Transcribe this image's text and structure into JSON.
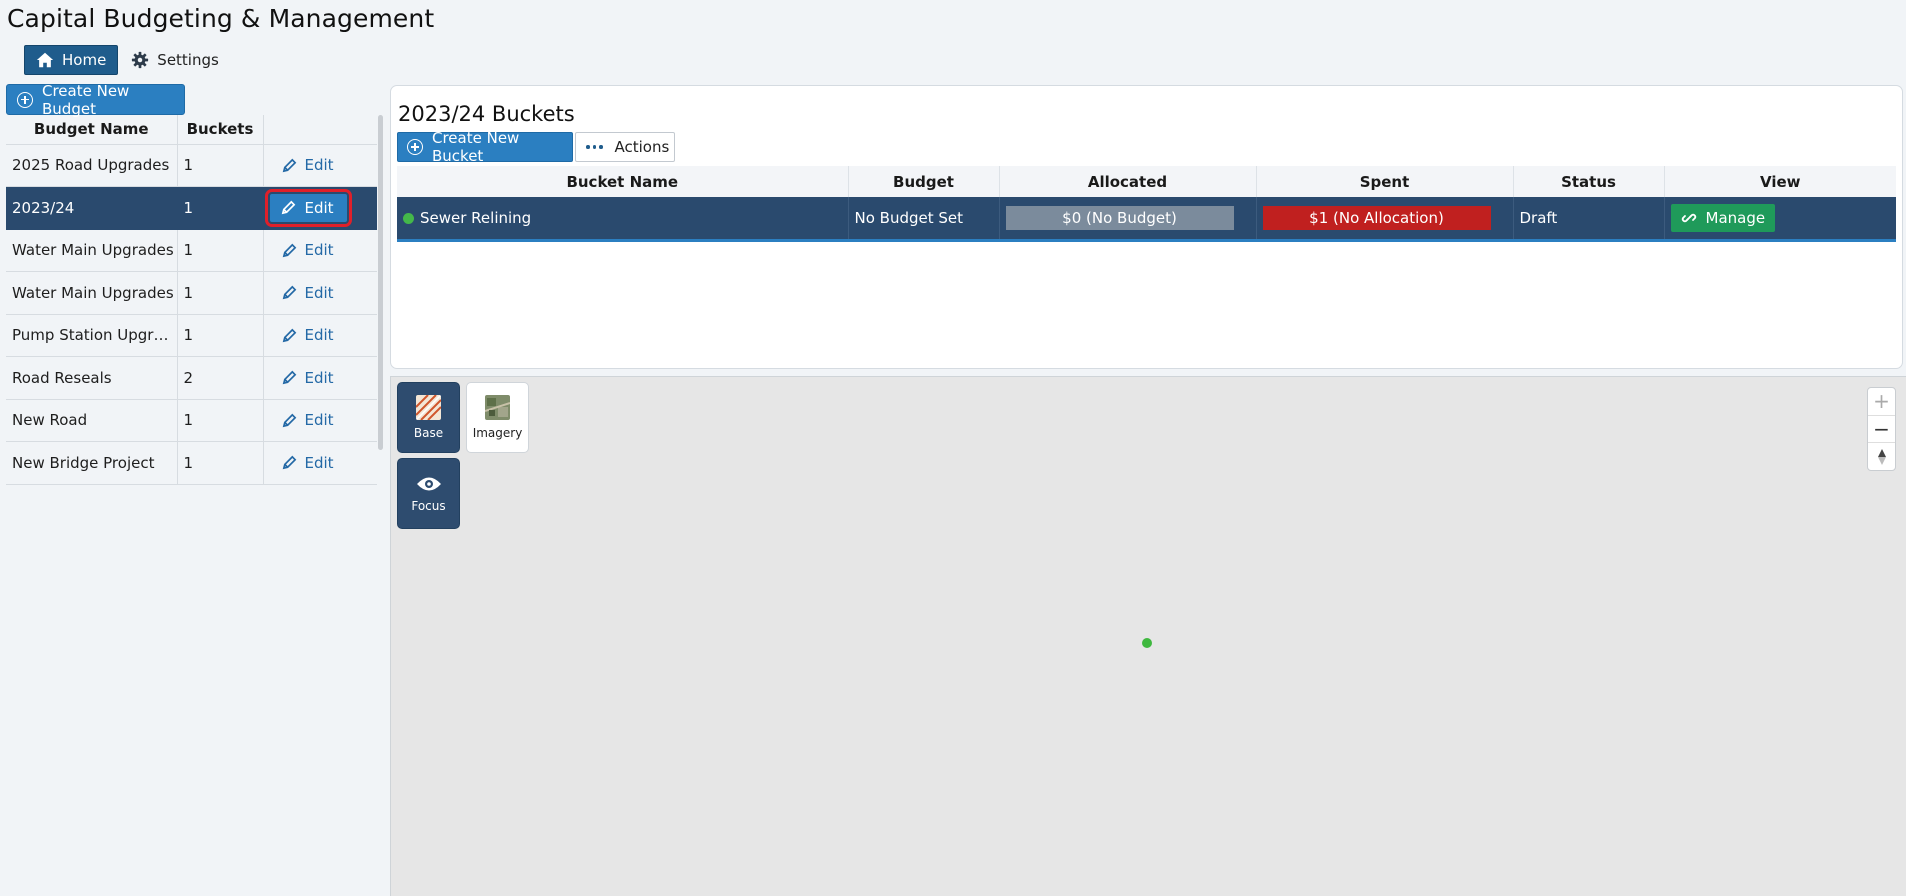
{
  "app": {
    "title": "Capital Budgeting & Management"
  },
  "nav": {
    "home": "Home",
    "settings": "Settings"
  },
  "sidebar": {
    "create_button": "Create New Budget",
    "columns": [
      "Budget Name",
      "Buckets",
      ""
    ],
    "edit_label": "Edit",
    "rows": [
      {
        "name": "2025 Road Upgrades",
        "buckets": "1"
      },
      {
        "name": "2023/24",
        "buckets": "1"
      },
      {
        "name": "Water Main Upgrades",
        "buckets": "1"
      },
      {
        "name": "Water Main Upgrades",
        "buckets": "1"
      },
      {
        "name": "Pump Station Upgrades",
        "buckets": "1"
      },
      {
        "name": "Road Reseals",
        "buckets": "2"
      },
      {
        "name": "New Road",
        "buckets": "1"
      },
      {
        "name": "New Bridge Project",
        "buckets": "1"
      }
    ]
  },
  "buckets": {
    "title": "2023/24 Buckets",
    "create_button": "Create New Bucket",
    "actions_button": "Actions",
    "columns": [
      "Bucket Name",
      "Budget",
      "Allocated",
      "Spent",
      "Status",
      "View"
    ],
    "rows": [
      {
        "name": "Sewer Relining",
        "budget": "No Budget Set",
        "allocated": "$0 (No Budget)",
        "spent": "$1 (No Allocation)",
        "status": "Draft",
        "view": "Manage"
      }
    ]
  },
  "map": {
    "layers": {
      "base": "Base",
      "imagery": "Imagery",
      "focus": "Focus"
    },
    "zoom_in": "+",
    "zoom_out": "−"
  },
  "colors": {
    "primary": "#2b7fc1",
    "selected_row": "#2a4a6e",
    "spent_red": "#c0201f",
    "manage_green": "#1f9a5a",
    "status_green": "#44b84a"
  }
}
